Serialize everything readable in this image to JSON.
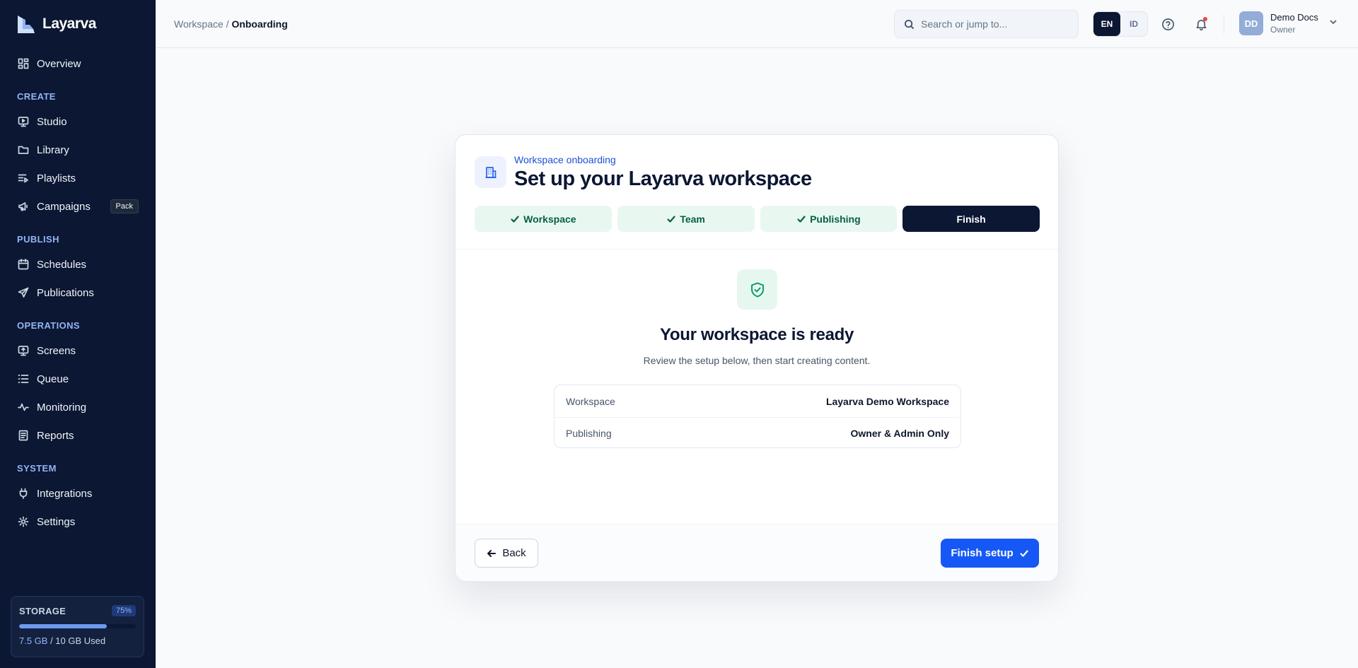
{
  "app": {
    "name": "Layarva"
  },
  "sidebar": {
    "overview": "Overview",
    "sections": {
      "create": "CREATE",
      "publish": "PUBLISH",
      "operations": "OPERATIONS",
      "system": "SYSTEM"
    },
    "items": {
      "studio": "Studio",
      "library": "Library",
      "playlists": "Playlists",
      "campaigns": "Campaigns",
      "campaigns_badge": "Pack",
      "schedules": "Schedules",
      "publications": "Publications",
      "screens": "Screens",
      "queue": "Queue",
      "monitoring": "Monitoring",
      "reports": "Reports",
      "integrations": "Integrations",
      "settings": "Settings"
    },
    "storage": {
      "label": "STORAGE",
      "percent_label": "75%",
      "fill_fraction": 0.75,
      "used": "7.5 GB",
      "total": " / 10 GB Used"
    }
  },
  "topbar": {
    "breadcrumb_parent": "Workspace / ",
    "breadcrumb_current": "Onboarding",
    "search_placeholder": "Search or jump to...",
    "lang_en": "EN",
    "lang_id": "ID",
    "user": {
      "initials": "DD",
      "name": "Demo Docs",
      "role": "Owner"
    }
  },
  "card": {
    "eyebrow": "Workspace onboarding",
    "title": "Set up your Layarva workspace",
    "steps": [
      {
        "label": "Workspace",
        "state": "done"
      },
      {
        "label": "Team",
        "state": "done"
      },
      {
        "label": "Publishing",
        "state": "done"
      },
      {
        "label": "Finish",
        "state": "current"
      }
    ],
    "ready_title": "Your workspace is ready",
    "ready_sub": "Review the setup below, then start creating content.",
    "summary": [
      {
        "key": "Workspace",
        "value": "Layarva Demo Workspace"
      },
      {
        "key": "Publishing",
        "value": "Owner & Admin Only"
      }
    ],
    "back_label": "Back",
    "finish_label": "Finish setup"
  },
  "colors": {
    "sidebar_bg": "#0b1733",
    "accent": "#1558f5",
    "success": "#059669"
  }
}
